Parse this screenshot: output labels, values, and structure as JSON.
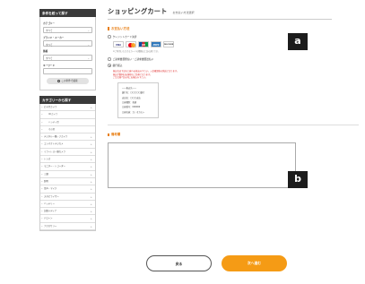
{
  "sidebar": {
    "search_header": "条件を絞って探す",
    "fields": [
      {
        "label": "カテゴリー",
        "value": "すべて"
      },
      {
        "label": "ブランド・メーカー",
        "value": "すべて"
      },
      {
        "label": "価格",
        "value": "すべて"
      }
    ],
    "keyword_label": "キーワード",
    "search_button": "この条件で検索",
    "category_header": "カテゴリーから探す",
    "categories": [
      {
        "label": "ビデオカメラ",
        "sub": false
      },
      {
        "label": "4Kカメラ",
        "sub": true
      },
      {
        "label": "ハンディ型",
        "sub": true
      },
      {
        "label": "その他",
        "sub": true
      },
      {
        "label": "デジタル一眼レフカメラ",
        "sub": false
      },
      {
        "label": "コンパクトデジカメ",
        "sub": false
      },
      {
        "label": "ミラーレス一眼カメラ",
        "sub": false
      },
      {
        "label": "レンズ",
        "sub": false
      },
      {
        "label": "モニター・レコーダー",
        "sub": false
      },
      {
        "label": "三脚",
        "sub": false
      },
      {
        "label": "照明",
        "sub": false
      },
      {
        "label": "音声・マイク",
        "sub": false
      },
      {
        "label": "スタビライザー",
        "sub": false
      },
      {
        "label": "バッテリー",
        "sub": false
      },
      {
        "label": "記録メディア",
        "sub": false
      },
      {
        "label": "ドローン",
        "sub": false
      },
      {
        "label": "アクセサリー",
        "sub": false
      }
    ]
  },
  "main": {
    "title": "ショッピングカート",
    "subtitle": "お支払い方法選択",
    "payment_section_title": "お支払い方法",
    "payment_options": {
      "credit": "クレジットカード決済",
      "card_brands": [
        "VISA",
        "MasterCard",
        "JCB",
        "AMEX",
        "DISCOVER"
      ],
      "card_note": "※ご利用いただけるカードの種類は上記の通りです。",
      "cod": "ご請求書郵便払い・ご請求書郵送払い",
      "bank": "銀行振込",
      "bank_notes": [
        "振込先は下記の口座へお振込み下さい。入金確認後の発送となります。",
        "振込手数料はお客様のご負担となります。",
        "ご注文後7日以内にお振込み下さい。"
      ],
      "bank_info": [
        "――振込先――",
        "銀行名：〇〇〇〇〇銀行",
        "支店名：〇〇〇支店",
        "口座種別：普通",
        "口座番号：000000",
        "口座名義：カ）オカモト"
      ]
    },
    "remarks_section_title": "備考欄"
  },
  "buttons": {
    "back": "戻る",
    "next": "次へ進む"
  },
  "badges": {
    "a": "a",
    "b": "b"
  }
}
